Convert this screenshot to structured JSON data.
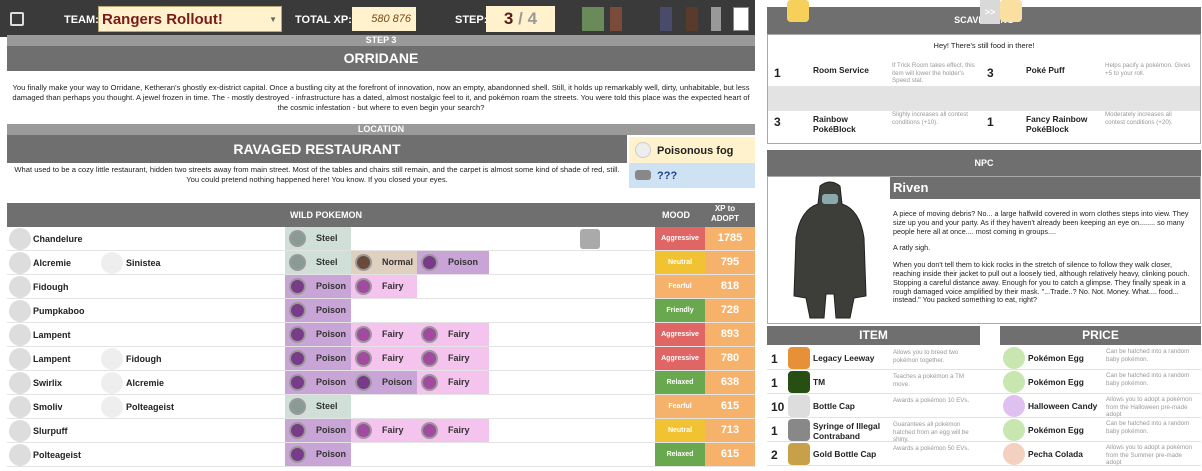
{
  "header": {
    "team_label": "TEAM:",
    "team_name": "Rangers Rollout!",
    "xp_label": "TOTAL XP:",
    "xp_value": "580 876",
    "step_label": "STEP:",
    "step_current": "3",
    "step_sep": "/",
    "step_total": "4"
  },
  "step": {
    "label": "STEP 3",
    "title": "ORRIDANE",
    "description": "You finally make your way to Orridane, Ketheran's ghostly ex-district capital. Once a bustling city at the forefront of innovation, now an empty, abandonned shell. Still, it holds up remarkably well, dirty, unhabitable, but less damaged than perhaps you thought. A jewel frozen in time. The - mostly destroyed - infrastructure has a dated, almost nostalgic feel to it, and pokémon roam the streets. You were told this place was the expected heart of the cosmic infestation - but where to even begin your search?"
  },
  "location": {
    "label": "LOCATION",
    "title": "RAVAGED RESTAURANT",
    "description": "What used to be a cozy little restaurant, hidden two streets away from main street. Most of the tables and chairs still remain, and the carpet is almost some kind of shade of red, still. You could pretend nothing happened here! You know. If you closed your eyes.",
    "weather": "Poisonous fog",
    "unknown": "???"
  },
  "wild": {
    "header": "WILD POKEMON",
    "mood_header": "MOOD",
    "xp_header": "XP to ADOPT",
    "rows": [
      {
        "p1": "Chandelure",
        "p2": "",
        "t1": "Steel",
        "t2": "",
        "t3": "",
        "mood": "Aggressive",
        "xp": "1785"
      },
      {
        "p1": "Alcremie",
        "p2": "Sinistea",
        "t1": "Steel",
        "t2": "Normal",
        "t3": "Poison",
        "mood": "Neutral",
        "xp": "795"
      },
      {
        "p1": "Fidough",
        "p2": "",
        "t1": "Poison",
        "t2": "Fairy",
        "t3": "",
        "mood": "Fearful",
        "xp": "818"
      },
      {
        "p1": "Pumpkaboo",
        "p2": "",
        "t1": "Poison",
        "t2": "",
        "t3": "",
        "mood": "Friendly",
        "xp": "728"
      },
      {
        "p1": "Lampent",
        "p2": "",
        "t1": "Poison",
        "t2": "Fairy",
        "t3": "Fairy",
        "mood": "Aggressive",
        "xp": "893"
      },
      {
        "p1": "Lampent",
        "p2": "Fidough",
        "t1": "Poison",
        "t2": "Fairy",
        "t3": "Fairy",
        "mood": "Aggressive",
        "xp": "780"
      },
      {
        "p1": "Swirlix",
        "p2": "Alcremie",
        "t1": "Poison",
        "t2": "Poison",
        "t3": "Fairy",
        "mood": "Relaxed",
        "xp": "638"
      },
      {
        "p1": "Smoliv",
        "p2": "Polteageist",
        "t1": "Steel",
        "t2": "",
        "t3": "",
        "mood": "Fearful",
        "xp": "615"
      },
      {
        "p1": "Slurpuff",
        "p2": "",
        "t1": "Poison",
        "t2": "Fairy",
        "t3": "Fairy",
        "mood": "Neutral",
        "xp": "713"
      },
      {
        "p1": "Polteageist",
        "p2": "",
        "t1": "Poison",
        "t2": "",
        "t3": "",
        "mood": "Relaxed",
        "xp": "615"
      }
    ]
  },
  "scavenging": {
    "header": "SCAVENGING",
    "message": "Hey! There's still food in there!",
    "items": [
      {
        "qty": "1",
        "name": "Room Service",
        "desc": "If Trick Room takes effect, this item will lower the holder's Speed stat."
      },
      {
        "qty": "3",
        "name": "Poké Puff",
        "desc": "Helps pacify a pokémon. Gives +5 to your roll."
      },
      {
        "qty": "3",
        "name": "Rainbow PokéBlock",
        "desc": "Slighly increases all contest conditions (+10)."
      },
      {
        "qty": "1",
        "name": "Fancy Rainbow PokéBlock",
        "desc": "Moderately increases all contest conditions (+20)."
      }
    ]
  },
  "npc": {
    "header": "NPC",
    "name": "Riven",
    "p1": "A piece of moving debris? No... a large halfwild covered in worn clothes steps into view. They size up you and your party. As if they haven't already been keeping an eye on........ so many people here all at once.... most coming in groups....",
    "p2": "A ratly sigh.",
    "p3": "When you don't tell them to kick rocks in the stretch of silence to follow they walk closer, reaching inside their jacket to pull out a loosely tied, although relatively heavy, clinking pouch. Stopping a careful distance away. Enough for you to catch a glimpse. They finally speak in a rough damaged voice amplified by their mask. \"...Trade..? No. Not. Money. What.... food... instead.\" You packed something to eat, right?",
    "item_header": "ITEM",
    "price_header": "PRICE",
    "arrow": ">>",
    "trades": [
      {
        "qty": "1",
        "item": "Legacy Leeway",
        "idesc": "Allows you to breed two pokémon together.",
        "price": "Pokémon Egg",
        "pdesc": "Can be hatched into a random baby pokémon."
      },
      {
        "qty": "1",
        "item": "TM",
        "idesc": "Teaches a pokémon a TM move.",
        "price": "Pokémon Egg",
        "pdesc": "Can be hatched into a random baby pokémon."
      },
      {
        "qty": "10",
        "item": "Bottle Cap",
        "idesc": "Awards a pokémon 10 EVs.",
        "price": "Halloween Candy",
        "pdesc": "Allows you to adopt a pokémon from the Halloween pre-made adopt"
      },
      {
        "qty": "1",
        "item": "Syringe of Illegal Contraband",
        "idesc": "Guarantees all pokémon hatched from an egg will be shiny.",
        "price": "Pokémon Egg",
        "pdesc": "Can be hatched into a random baby pokémon."
      },
      {
        "qty": "2",
        "item": "Gold Bottle Cap",
        "idesc": "Awards a pokémon 50 EVs.",
        "price": "Pecha Colada",
        "pdesc": "Allows you to adopt a pokémon from the Summer pre-made adopt"
      }
    ]
  }
}
